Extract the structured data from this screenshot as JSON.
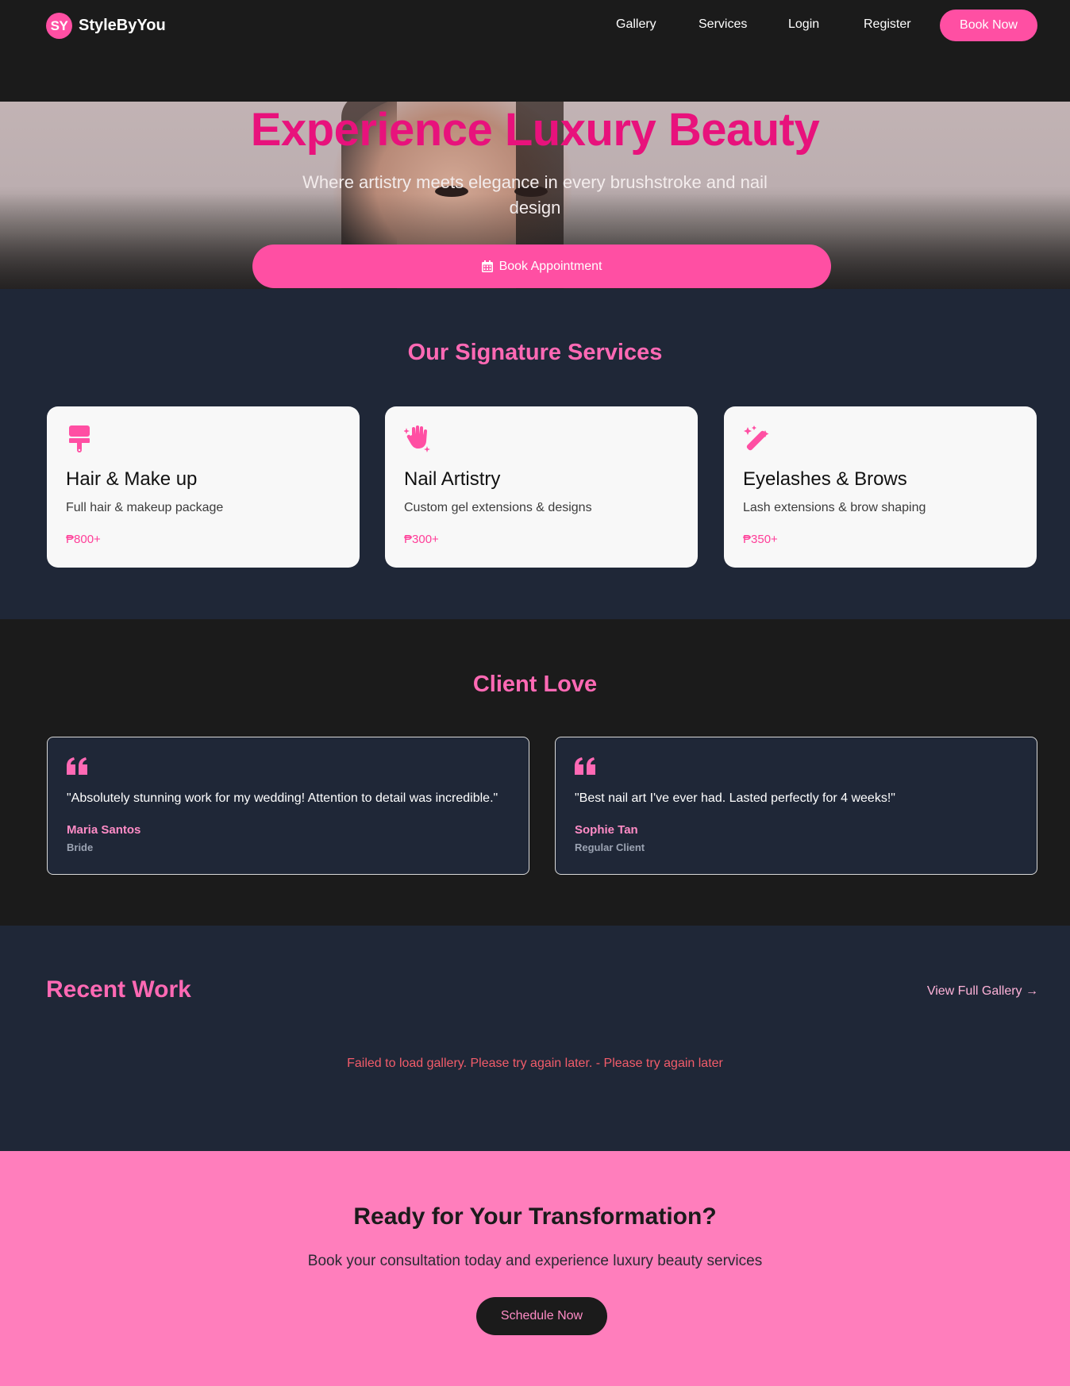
{
  "brand": {
    "badge": "SY",
    "name": "StyleByYou",
    "accent": "#ff4fa3"
  },
  "nav": {
    "items": [
      {
        "label": "Gallery"
      },
      {
        "label": "Services"
      },
      {
        "label": "Login"
      },
      {
        "label": "Register"
      }
    ],
    "cta_label": "Book Now"
  },
  "hero": {
    "title": "Experience Luxury Beauty",
    "subtitle": "Where artistry meets elegance in every brushstroke and nail design",
    "button_label": "Book Appointment",
    "button_icon": "calendar-icon"
  },
  "services": {
    "title": "Our Signature Services",
    "cards": [
      {
        "icon": "paint-brush-icon",
        "title": "Hair & Make up",
        "desc": "Full hair & makeup package",
        "price": "₱800+"
      },
      {
        "icon": "sparkle-hand-icon",
        "title": "Nail Artistry",
        "desc": "Custom gel extensions & designs",
        "price": "₱300+"
      },
      {
        "icon": "magic-wand-icon",
        "title": "Eyelashes & Brows",
        "desc": "Lash extensions & brow shaping",
        "price": "₱350+"
      }
    ]
  },
  "testimonials": {
    "title": "Client Love",
    "items": [
      {
        "quote": "\"Absolutely stunning work for my wedding! Attention to detail was incredible.\"",
        "name": "Maria Santos",
        "role": "Bride"
      },
      {
        "quote": "\"Best nail art I've ever had. Lasted perfectly for 4 weeks!\"",
        "name": "Sophie Tan",
        "role": "Regular Client"
      }
    ]
  },
  "recent_work": {
    "title": "Recent Work",
    "link_label": "View Full Gallery →",
    "error_message": "Failed to load gallery. Please try again later. - Please try again later"
  },
  "cta": {
    "title": "Ready for Your Transformation?",
    "subtitle": "Book your consultation today and experience luxury beauty services",
    "button_label": "Schedule Now"
  }
}
